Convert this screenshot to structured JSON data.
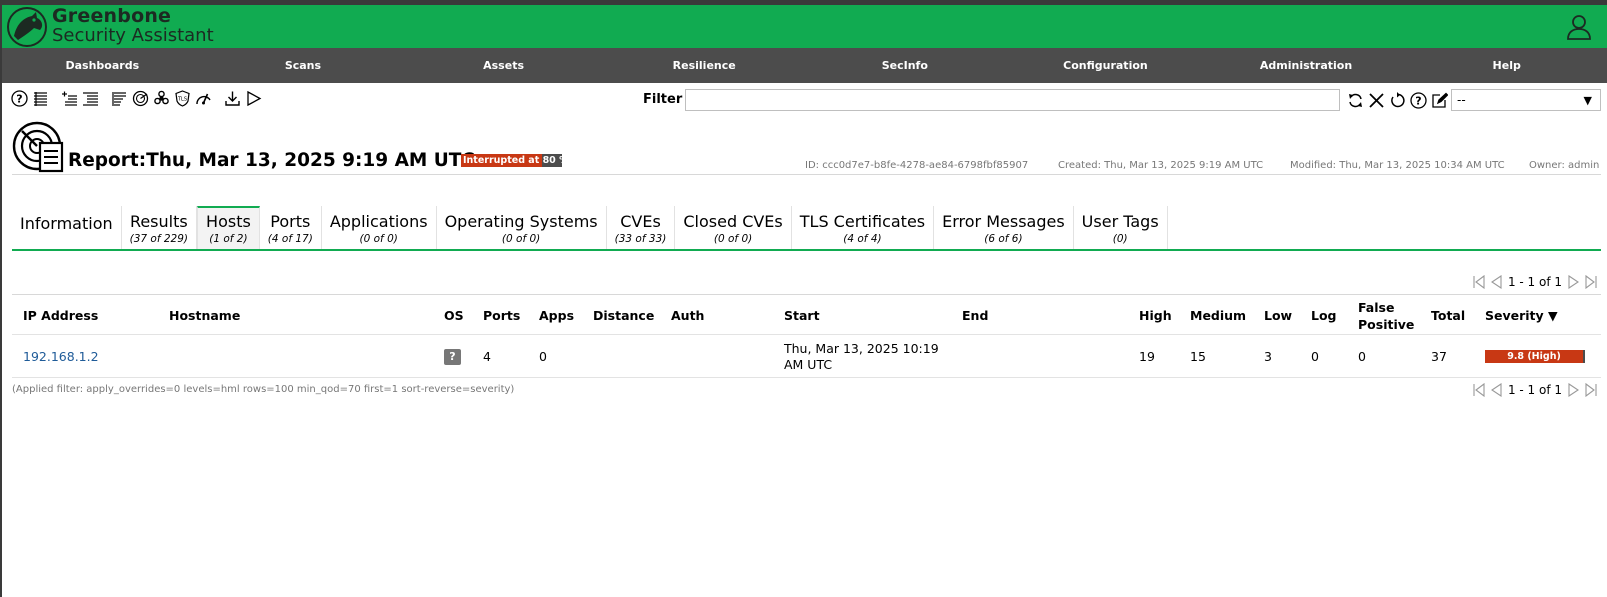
{
  "app": {
    "brand_line1": "Greenbone",
    "brand_line2": "Security Assistant"
  },
  "menu": [
    "Dashboards",
    "Scans",
    "Assets",
    "Resilience",
    "SecInfo",
    "Configuration",
    "Administration",
    "Help"
  ],
  "filter": {
    "label": "Filter",
    "value": "",
    "select_value": "--"
  },
  "report": {
    "title": "Report:Thu, Mar 13, 2025 9:19 AM UTC",
    "status": "Interrupted at 80 %",
    "progress_percent": 80,
    "id": "ID: ccc0d7e7-b8fe-4278-ae84-6798fbf85907",
    "created": "Created: Thu, Mar 13, 2025 9:19 AM UTC",
    "modified": "Modified: Thu, Mar 13, 2025 10:34 AM UTC",
    "owner": "Owner: admin"
  },
  "tabs": [
    {
      "label": "Information",
      "count": ""
    },
    {
      "label": "Results",
      "count": "(37 of 229)"
    },
    {
      "label": "Hosts",
      "count": "(1 of 2)"
    },
    {
      "label": "Ports",
      "count": "(4 of 17)"
    },
    {
      "label": "Applications",
      "count": "(0 of 0)"
    },
    {
      "label": "Operating Systems",
      "count": "(0 of 0)"
    },
    {
      "label": "CVEs",
      "count": "(33 of 33)"
    },
    {
      "label": "Closed CVEs",
      "count": "(0 of 0)"
    },
    {
      "label": "TLS Certificates",
      "count": "(4 of 4)"
    },
    {
      "label": "Error Messages",
      "count": "(6 of 6)"
    },
    {
      "label": "User Tags",
      "count": "(0)"
    }
  ],
  "active_tab": "Hosts",
  "pagination": {
    "text": "1 - 1 of 1"
  },
  "table": {
    "headers": {
      "ip": "IP Address",
      "hostname": "Hostname",
      "os": "OS",
      "ports": "Ports",
      "apps": "Apps",
      "distance": "Distance",
      "auth": "Auth",
      "start": "Start",
      "end": "End",
      "high": "High",
      "medium": "Medium",
      "low": "Low",
      "log": "Log",
      "false_positive_1": "False",
      "false_positive_2": "Positive",
      "total": "Total",
      "severity": "Severity ▼"
    },
    "rows": [
      {
        "ip": "192.168.1.2",
        "hostname": "",
        "os": "?",
        "ports": "4",
        "apps": "0",
        "distance": "",
        "auth": "",
        "start_1": "Thu, Mar 13, 2025 10:19",
        "start_2": "AM UTC",
        "end": "",
        "high": "19",
        "medium": "15",
        "low": "3",
        "log": "0",
        "false_positive": "0",
        "total": "37",
        "severity": "9.8 (High)"
      }
    ]
  },
  "applied_filter": "(Applied filter: apply_overrides=0 levels=hml rows=100 min_qod=70 first=1 sort-reverse=severity)",
  "colors": {
    "brand_green": "#11ab51",
    "menu_bg": "#4c4c4c",
    "severity_high": "#c83814"
  }
}
